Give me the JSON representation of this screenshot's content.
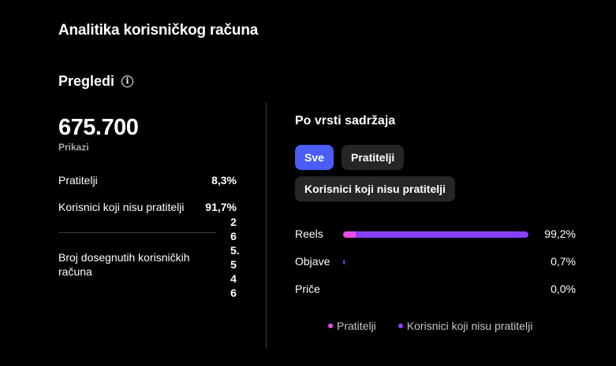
{
  "page_title": "Analitika korisničkog računa",
  "overview": {
    "title": "Pregledi",
    "info_icon": "info-icon",
    "total_value": "675.700",
    "total_label": "Prikazi",
    "stats": [
      {
        "label": "Pratitelji",
        "value": "8,3%"
      },
      {
        "label": "Korisnici koji nisu pratitelji",
        "value": "91,7%"
      }
    ],
    "reached_label": "Broj dosegnutih korisničkih računa",
    "reached_value": "265.546"
  },
  "content_type": {
    "title": "Po vrsti sadržaja",
    "filters": [
      {
        "label": "Sve",
        "active": true
      },
      {
        "label": "Pratitelji",
        "active": false
      },
      {
        "label": "Korisnici koji nisu pratitelji",
        "active": false
      }
    ],
    "rows": [
      {
        "label": "Reels",
        "value": "99,2%",
        "followers_fraction": 0.07,
        "nonfollowers_fraction": 0.93
      },
      {
        "label": "Objave",
        "value": "0,7%",
        "followers_fraction": 0.0,
        "nonfollowers_fraction": 0.007
      },
      {
        "label": "Priče",
        "value": "0,0%",
        "followers_fraction": 0.0,
        "nonfollowers_fraction": 0.0
      }
    ],
    "legend": [
      {
        "label": "Pratitelji",
        "color": "#e84de6"
      },
      {
        "label": "Korisnici koji nisu pratitelji",
        "color": "#8a3ffc"
      }
    ]
  }
}
